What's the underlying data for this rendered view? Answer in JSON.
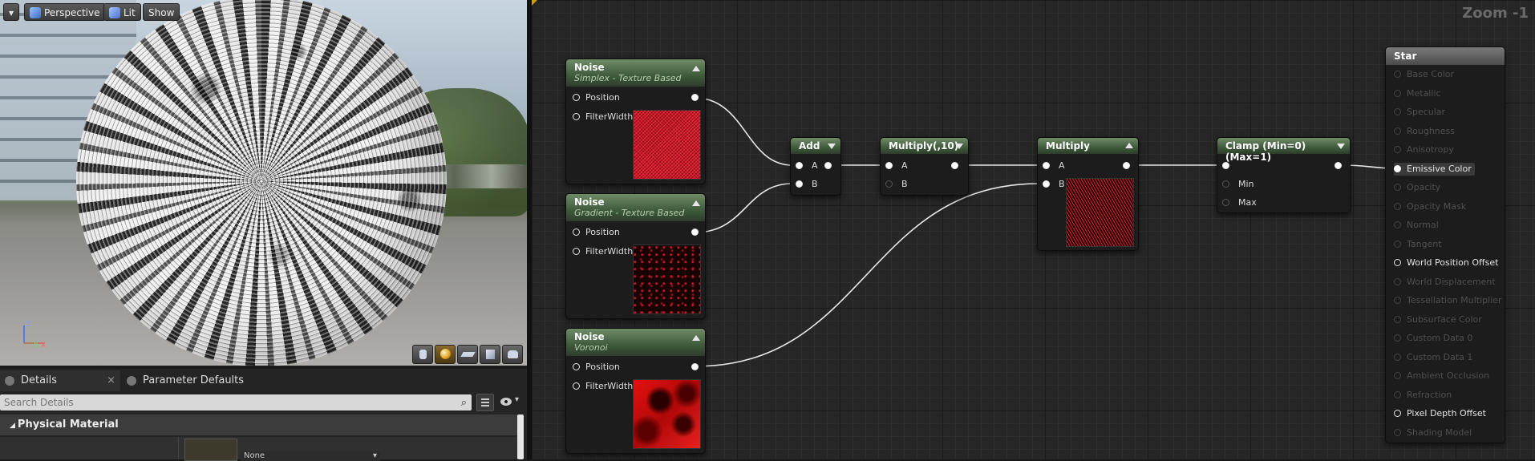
{
  "viewport": {
    "menu_label": "▾",
    "perspective_label": "Perspective",
    "lit_label": "Lit",
    "show_label": "Show",
    "axis": {
      "z": "Z",
      "y": "Y",
      "x": "X"
    }
  },
  "details": {
    "tabs": [
      {
        "label": "Details"
      },
      {
        "label": "Parameter Defaults"
      }
    ],
    "search_placeholder": "Search Details",
    "category": "Physical Material",
    "dropdown_value": "None"
  },
  "graph": {
    "zoom_label": "Zoom -1",
    "nodes": {
      "noise1": {
        "title": "Noise",
        "subtitle": "Simplex - Texture Based",
        "pins": [
          "Position",
          "FilterWidth"
        ]
      },
      "noise2": {
        "title": "Noise",
        "subtitle": "Gradient - Texture Based",
        "pins": [
          "Position",
          "FilterWidth"
        ]
      },
      "noise3": {
        "title": "Noise",
        "subtitle": "Voronoi",
        "pins": [
          "Position",
          "FilterWidth"
        ]
      },
      "add": {
        "title": "Add",
        "pins": [
          "A",
          "B"
        ]
      },
      "multiply10": {
        "title": "Multiply(,10)",
        "pins": [
          "A",
          "B"
        ]
      },
      "multiply": {
        "title": "Multiply",
        "pins": [
          "A",
          "B"
        ]
      },
      "clamp": {
        "title": "Clamp (Min=0) (Max=1)",
        "pins": [
          "",
          "Min",
          "Max"
        ]
      }
    },
    "result": {
      "title": "Star",
      "pins": [
        {
          "label": "Base Color",
          "active": false
        },
        {
          "label": "Metallic",
          "active": false
        },
        {
          "label": "Specular",
          "active": false
        },
        {
          "label": "Roughness",
          "active": false
        },
        {
          "label": "Anisotropy",
          "active": false
        },
        {
          "label": "Emissive Color",
          "active": true,
          "connected": true
        },
        {
          "label": "Opacity",
          "active": false
        },
        {
          "label": "Opacity Mask",
          "active": false
        },
        {
          "label": "Normal",
          "active": false
        },
        {
          "label": "Tangent",
          "active": false
        },
        {
          "label": "World Position Offset",
          "active": true
        },
        {
          "label": "World Displacement",
          "active": false
        },
        {
          "label": "Tessellation Multiplier",
          "active": false
        },
        {
          "label": "Subsurface Color",
          "active": false
        },
        {
          "label": "Custom Data 0",
          "active": false
        },
        {
          "label": "Custom Data 1",
          "active": false
        },
        {
          "label": "Ambient Occlusion",
          "active": false
        },
        {
          "label": "Refraction",
          "active": false
        },
        {
          "label": "Pixel Depth Offset",
          "active": true
        },
        {
          "label": "Shading Model",
          "active": false
        }
      ]
    }
  }
}
